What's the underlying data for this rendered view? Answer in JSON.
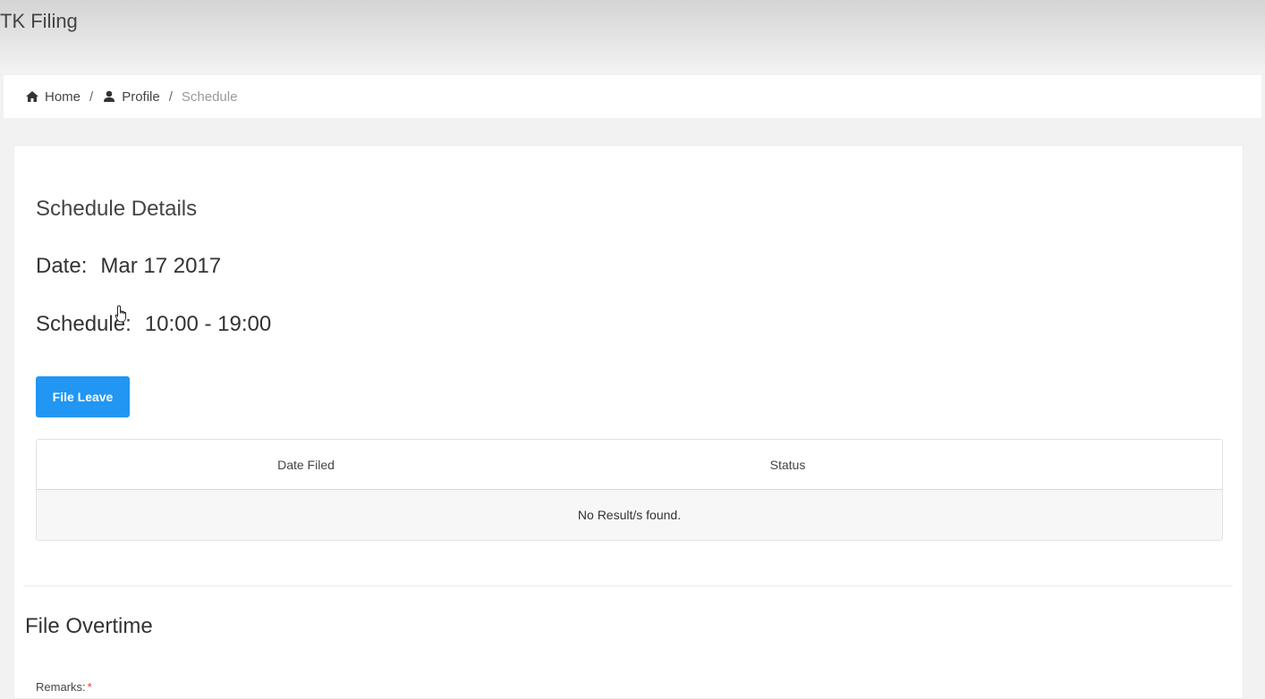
{
  "app": {
    "title": "TK Filing"
  },
  "breadcrumb": [
    {
      "label": "Home",
      "icon": "home-icon"
    },
    {
      "label": "Profile",
      "icon": "user-icon"
    },
    {
      "label": "Schedule"
    }
  ],
  "breadcrumb_separator": "/",
  "schedule": {
    "heading": "Schedule Details",
    "date_label": "Date:",
    "date_value": "Mar 17 2017",
    "schedule_label": "Schedule:",
    "schedule_value": "10:00 - 19:00",
    "file_leave_button": "File Leave"
  },
  "leave_table": {
    "columns": [
      "Date Filed",
      "Status"
    ],
    "empty_message": "No Result/s found."
  },
  "overtime": {
    "heading": "File Overtime",
    "remarks_label": "Remarks:",
    "required_marker": "*"
  },
  "colors": {
    "primary_button": "#2196f3",
    "required": "#e53935"
  }
}
